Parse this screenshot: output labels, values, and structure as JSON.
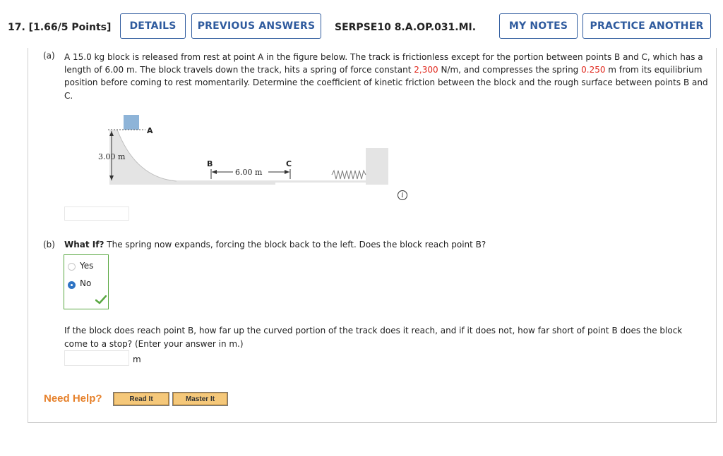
{
  "header": {
    "question_label": "17.  [1.66/5 Points]",
    "details": "DETAILS",
    "previous_answers": "PREVIOUS ANSWERS",
    "assignment_id": "SERPSE10 8.A.OP.031.MI.",
    "my_notes": "MY NOTES",
    "practice_another": "PRACTICE ANOTHER"
  },
  "part_a": {
    "label": "(a)",
    "text_1": "A 15.0 kg block is released from rest at point A in the figure below. The track is frictionless except for the portion between points B and C, which has a length of 6.00 m. The block travels down the track, hits a spring of force constant ",
    "spring_constant": "2,300",
    "text_2": " N/m, and compresses the spring ",
    "compression": "0.250",
    "text_3": " m from its equilibrium position before coming to rest momentarily. Determine the coefficient of kinetic friction between the block and the rough surface between points B and C.",
    "answer_value": ""
  },
  "figure": {
    "label_a": "A",
    "label_b": "B",
    "label_c": "C",
    "height_label": "3.00 m",
    "length_label": "6.00 m",
    "colors": {
      "block": "#8eb4d8",
      "track": "#e4e4e4",
      "edge": "#333333"
    }
  },
  "part_b": {
    "label": "(b)",
    "what_if": "What If?",
    "question": " The spring now expands, forcing the block back to the left. Does the block reach point B?",
    "options": [
      "Yes",
      "No"
    ],
    "selected": "No",
    "followup": "If the block does reach point B, how far up the curved portion of the track does it reach, and if it does not, how far short of point B does the block come to a stop? (Enter your answer in m.)",
    "answer_value": "",
    "unit": "m"
  },
  "help": {
    "label": "Need Help?",
    "read_it": "Read It",
    "master_it": "Master It"
  },
  "colors": {
    "accent": "#2f5b9e",
    "correct": "#5aa842",
    "highlight": "#e0281d",
    "help_orange": "#e6802a"
  }
}
